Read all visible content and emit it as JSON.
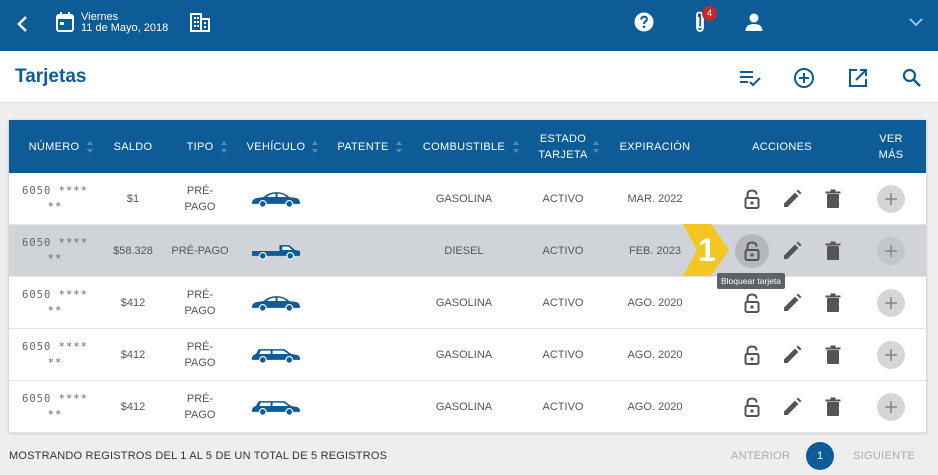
{
  "topbar": {
    "date_line1": "Viernes",
    "date_line2": "11 de Mayo, 2018",
    "notifications_count": "4",
    "icons": [
      "back-icon",
      "calendar-icon",
      "building-icon",
      "help-icon",
      "attachment-icon",
      "user-icon",
      "chevron-down-icon"
    ]
  },
  "subheader": {
    "title": "Tarjetas",
    "icons": [
      "checklist-icon",
      "add-circle-icon",
      "open-external-icon",
      "search-icon"
    ]
  },
  "table": {
    "columns": {
      "numero": "NÚMERO",
      "saldo": "SALDO",
      "tipo": "TIPO",
      "vehiculo": "VEHÍCULO",
      "patente": "PATENTE",
      "combustible": "COMBUSTIBLE",
      "estado": "ESTADO TARJETA",
      "expiracion": "EXPIRACIÓN",
      "acciones": "ACCIONES",
      "ver_mas": "VER MÁS"
    },
    "rows": [
      {
        "numero": "6050 **** **",
        "saldo": "$1",
        "tipo": "PRÉ-PAGO",
        "vehiculo": "sedan",
        "patente": "",
        "combustible": "GASOLINA",
        "estado": "ACTIVO",
        "expiracion": "MAR. 2022"
      },
      {
        "numero": "6050 **** **",
        "saldo": "$58.328",
        "tipo": "PRÉ-PAGO",
        "vehiculo": "pickup",
        "patente": "",
        "combustible": "DIESEL",
        "estado": "ACTIVO",
        "expiracion": "FEB. 2023"
      },
      {
        "numero": "6050 **** **",
        "saldo": "$412",
        "tipo": "PRÉ-PAGO",
        "vehiculo": "sedan",
        "patente": "",
        "combustible": "GASOLINA",
        "estado": "ACTIVO",
        "expiracion": "AGO. 2020"
      },
      {
        "numero": "6050 **** **",
        "saldo": "$412",
        "tipo": "PRÉ-PAGO",
        "vehiculo": "wagon",
        "patente": "",
        "combustible": "GASOLINA",
        "estado": "ACTIVO",
        "expiracion": "AGO. 2020"
      },
      {
        "numero": "6050 **** **",
        "saldo": "$412",
        "tipo": "PRÉ-PAGO",
        "vehiculo": "wagon",
        "patente": "",
        "combustible": "GASOLINA",
        "estado": "ACTIVO",
        "expiracion": "AGO. 2020"
      }
    ],
    "highlighted_row": 1,
    "tooltip": "Bloquear tarjeta",
    "step_marker": "1"
  },
  "footer": {
    "info": "MOSTRANDO REGISTROS DEL 1 AL 5 DE UN TOTAL DE 5 REGISTROS",
    "prev": "ANTERIOR",
    "page": "1",
    "next": "SIGUIENTE"
  },
  "colors": {
    "primary": "#0d5b97",
    "badge": "#c62828",
    "highlight_row": "#d0d4d8",
    "step_marker": "#f5c518"
  }
}
